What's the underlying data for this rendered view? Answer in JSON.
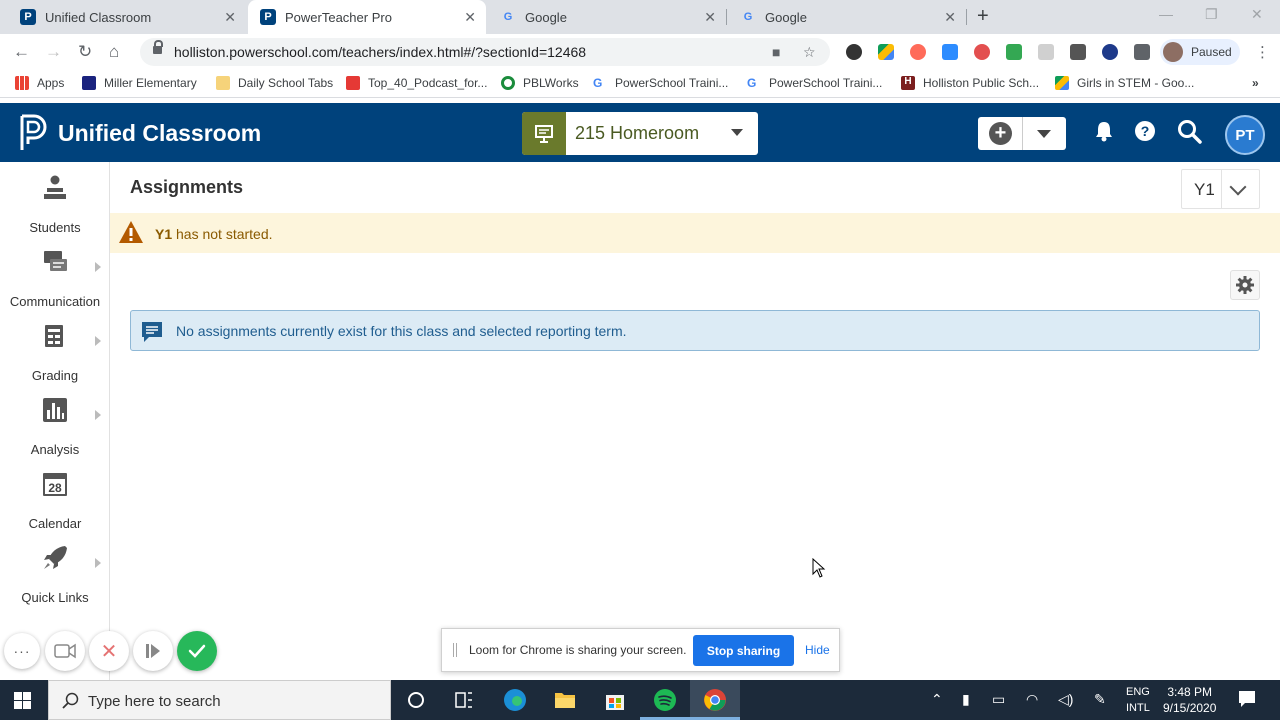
{
  "browser": {
    "tabs": [
      {
        "title": "Unified Classroom",
        "active": false
      },
      {
        "title": "PowerTeacher Pro",
        "active": true
      },
      {
        "title": "Google",
        "active": false
      },
      {
        "title": "Google",
        "active": false
      }
    ],
    "url": "holliston.powerschool.com/teachers/index.html#/?sectionId=12468",
    "profile_label": "Paused",
    "bookmarks": [
      {
        "label": "Apps",
        "icon": "apps-grid-icon"
      },
      {
        "label": "Miller Elementary",
        "icon": "school-icon"
      },
      {
        "label": "Daily School Tabs",
        "icon": "folder-icon"
      },
      {
        "label": "Top_40_Podcast_for...",
        "icon": "pdf-icon"
      },
      {
        "label": "PBLWorks",
        "icon": "circle-icon"
      },
      {
        "label": "PowerSchool Traini...",
        "icon": "google-icon"
      },
      {
        "label": "PowerSchool Traini...",
        "icon": "google-icon"
      },
      {
        "label": "Holliston Public Sch...",
        "icon": "h-logo-icon"
      },
      {
        "label": "Girls in STEM - Goo...",
        "icon": "drive-icon"
      }
    ]
  },
  "app": {
    "name": "Unified Classroom",
    "class_selector": "215 Homeroom",
    "user_initials": "PT",
    "colors": {
      "header": "#00427c",
      "class_icon": "#6a7a2c",
      "avatar": "#2a7bd0"
    }
  },
  "sidebar": {
    "items": [
      {
        "label": "Students",
        "icon": "students-icon",
        "has_submenu": false
      },
      {
        "label": "Communication",
        "icon": "communication-icon",
        "has_submenu": true
      },
      {
        "label": "Grading",
        "icon": "grading-icon",
        "has_submenu": true
      },
      {
        "label": "Analysis",
        "icon": "analysis-icon",
        "has_submenu": true
      },
      {
        "label": "Calendar",
        "icon": "calendar-icon",
        "has_submenu": false,
        "icon_text": "28"
      },
      {
        "label": "Quick Links",
        "icon": "rocket-icon",
        "has_submenu": true
      }
    ]
  },
  "main": {
    "title": "Assignments",
    "term": "Y1",
    "warning": {
      "term": "Y1",
      "text": " has not started."
    },
    "info": "No assignments currently exist for this class and selected reporting term."
  },
  "loom": {
    "message": "Loom for Chrome is sharing your screen.",
    "stop_label": "Stop sharing",
    "hide_label": "Hide"
  },
  "taskbar": {
    "search_placeholder": "Type here to search",
    "lang_line1": "ENG",
    "lang_line2": "INTL",
    "time": "3:48 PM",
    "date": "9/15/2020"
  }
}
